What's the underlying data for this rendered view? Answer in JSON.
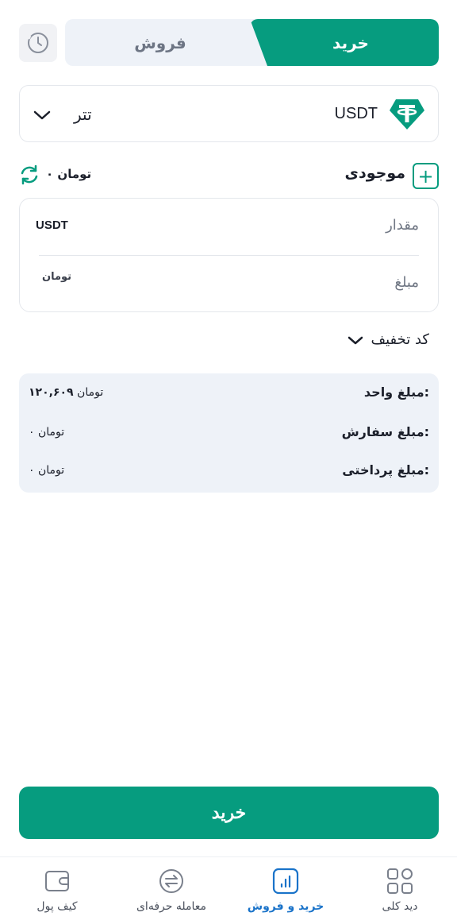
{
  "header": {
    "buy_tab": "خرید",
    "sell_tab": "فروش",
    "history_icon": "clock-icon"
  },
  "coin": {
    "symbol": "USDT",
    "name": "تتر",
    "icon": "tether-icon"
  },
  "balance": {
    "label": "موجودی",
    "value": "۰ تومان"
  },
  "inputs": {
    "amount_label": "مقدار",
    "amount_unit": "USDT",
    "price_label": "مبلغ",
    "price_unit": "تومان"
  },
  "discount": {
    "label": "کد تخفیف"
  },
  "summary": {
    "unit_price_label": "مبلغ واحد:",
    "unit_price_number": "۱۲۰,۶۰۹",
    "unit_price_currency": "تومان",
    "order_amount_label": "مبلغ سفارش:",
    "order_amount_value": "۰ تومان",
    "payment_amount_label": "مبلغ پرداختی:",
    "payment_amount_value": "۰ تومان"
  },
  "action": {
    "buy_label": "خرید"
  },
  "bottom_nav": {
    "overview": "دید کلی",
    "buy_sell": "خرید و فروش",
    "pro_trade": "معامله حرفه‌ای",
    "wallet": "کیف پول"
  },
  "colors": {
    "accent": "#069c7f",
    "nav_active": "#1a73c9",
    "summary_bg": "#eef2f8"
  }
}
